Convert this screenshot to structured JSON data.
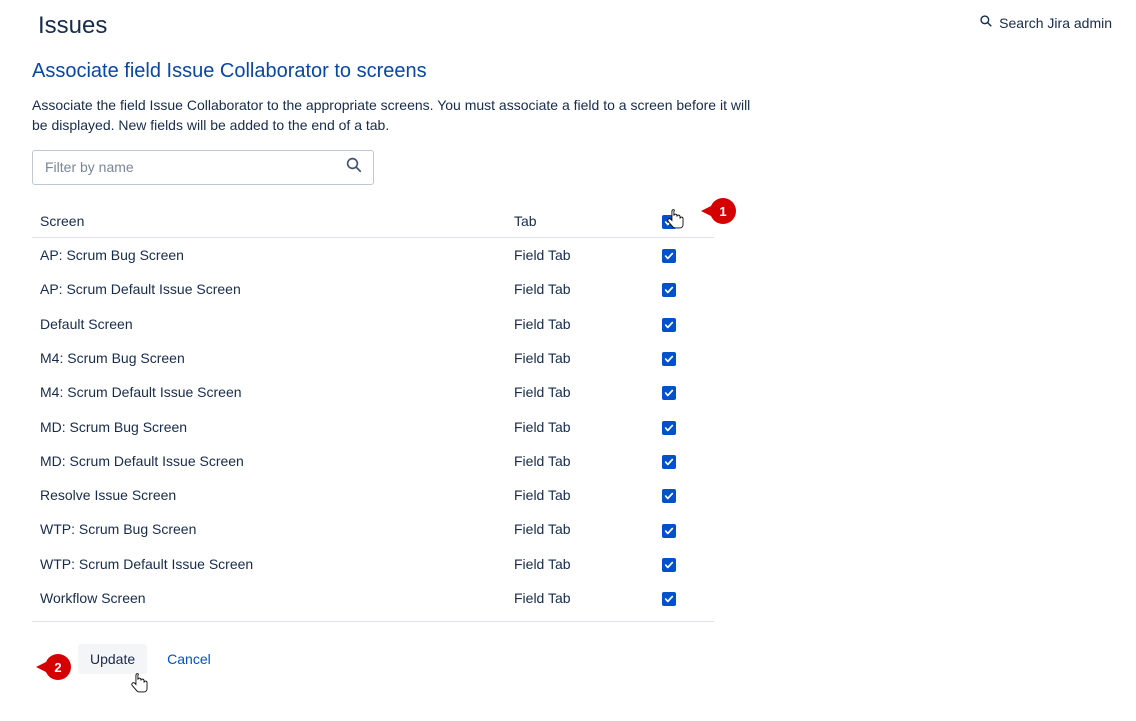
{
  "header": {
    "title": "Issues",
    "search_label": "Search Jira admin"
  },
  "subheading": "Associate field Issue Collaborator to screens",
  "description": "Associate the field Issue Collaborator to the appropriate screens. You must associate a field to a screen before it will be displayed. New fields will be added to the end of a tab.",
  "filter": {
    "placeholder": "Filter by name"
  },
  "table": {
    "col_screen": "Screen",
    "col_tab": "Tab",
    "rows": [
      {
        "screen": "AP: Scrum Bug Screen",
        "tab": "Field Tab",
        "checked": true
      },
      {
        "screen": "AP: Scrum Default Issue Screen",
        "tab": "Field Tab",
        "checked": true
      },
      {
        "screen": "Default Screen",
        "tab": "Field Tab",
        "checked": true
      },
      {
        "screen": "M4: Scrum Bug Screen",
        "tab": "Field Tab",
        "checked": true
      },
      {
        "screen": "M4: Scrum Default Issue Screen",
        "tab": "Field Tab",
        "checked": true
      },
      {
        "screen": "MD: Scrum Bug Screen",
        "tab": "Field Tab",
        "checked": true
      },
      {
        "screen": "MD: Scrum Default Issue Screen",
        "tab": "Field Tab",
        "checked": true
      },
      {
        "screen": "Resolve Issue Screen",
        "tab": "Field Tab",
        "checked": true
      },
      {
        "screen": "WTP: Scrum Bug Screen",
        "tab": "Field Tab",
        "checked": true
      },
      {
        "screen": "WTP: Scrum Default Issue Screen",
        "tab": "Field Tab",
        "checked": true
      },
      {
        "screen": "Workflow Screen",
        "tab": "Field Tab",
        "checked": true
      }
    ]
  },
  "actions": {
    "update_label": "Update",
    "cancel_label": "Cancel"
  },
  "callouts": {
    "one": "1",
    "two": "2"
  }
}
